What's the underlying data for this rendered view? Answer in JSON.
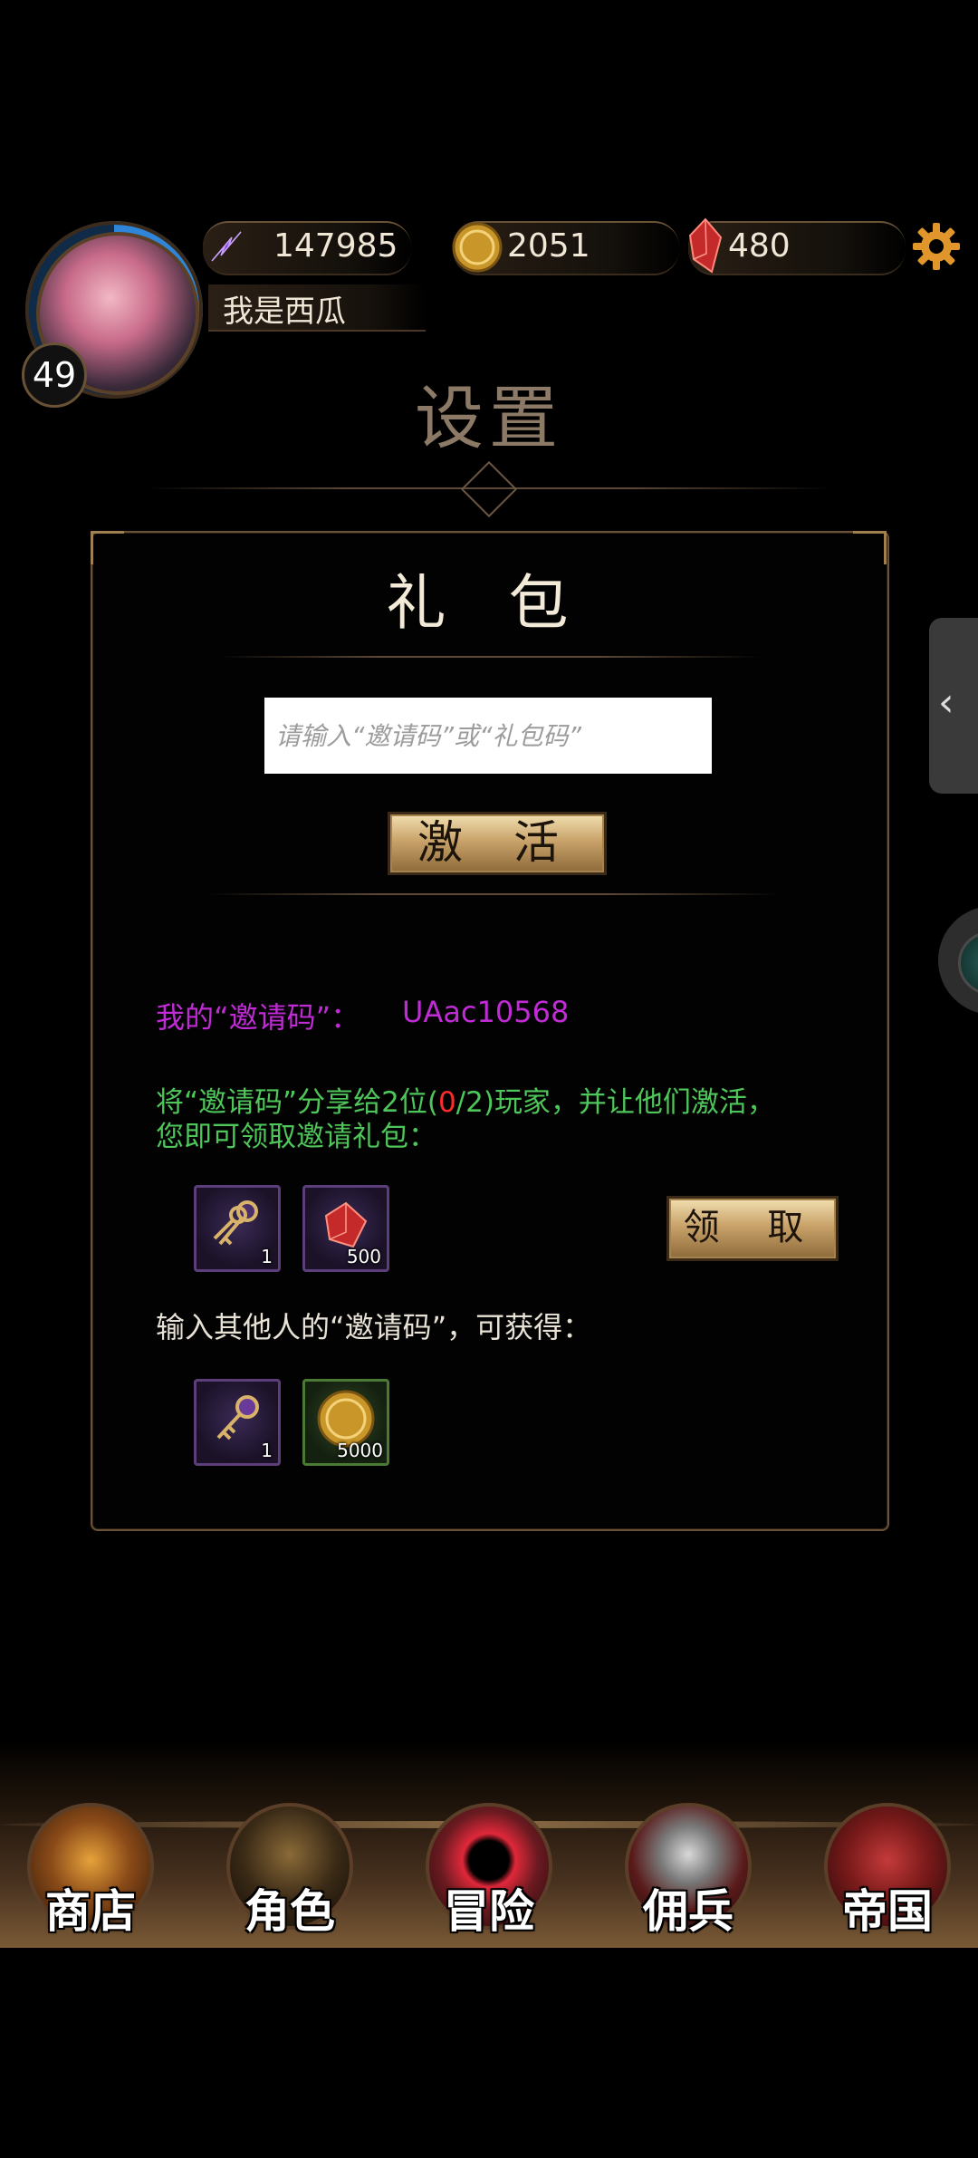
{
  "top_bar": {
    "energy": "147985",
    "gold": "2051",
    "gems": "480",
    "player_name": "我是西瓜",
    "level": "49"
  },
  "page": {
    "title": "设置"
  },
  "gift": {
    "title": "礼 包",
    "input_placeholder": "请输入“邀请码”或“礼包码”",
    "activate_label": "激 活",
    "my_code_label": "我的“邀请码”：",
    "my_code": "UAac10568",
    "share_line1_prefix": "将“邀请码”分享给2位(",
    "share_progress_done": "0",
    "share_progress_total": "/2)",
    "share_line1_suffix": "玩家，并让他们激活，",
    "share_line2": "您即可领取邀请礼包：",
    "claim_label": "领 取",
    "invite_rewards": [
      {
        "icon": "keys-icon",
        "count": "1"
      },
      {
        "icon": "red-crystal-icon",
        "count": "500"
      }
    ],
    "enter_label": "输入其他人的“邀请码”，可获得：",
    "enter_rewards": [
      {
        "icon": "key-icon",
        "count": "1"
      },
      {
        "icon": "gold-coin-icon",
        "count": "5000"
      }
    ]
  },
  "nav": {
    "shop": "商店",
    "character": "角色",
    "adventure": "冒险",
    "mercenary": "佣兵",
    "empire": "帝国"
  },
  "colors": {
    "purple_text": "#c02bd6",
    "green_text": "#4ec65a",
    "progress_red": "#ff2a2a"
  }
}
